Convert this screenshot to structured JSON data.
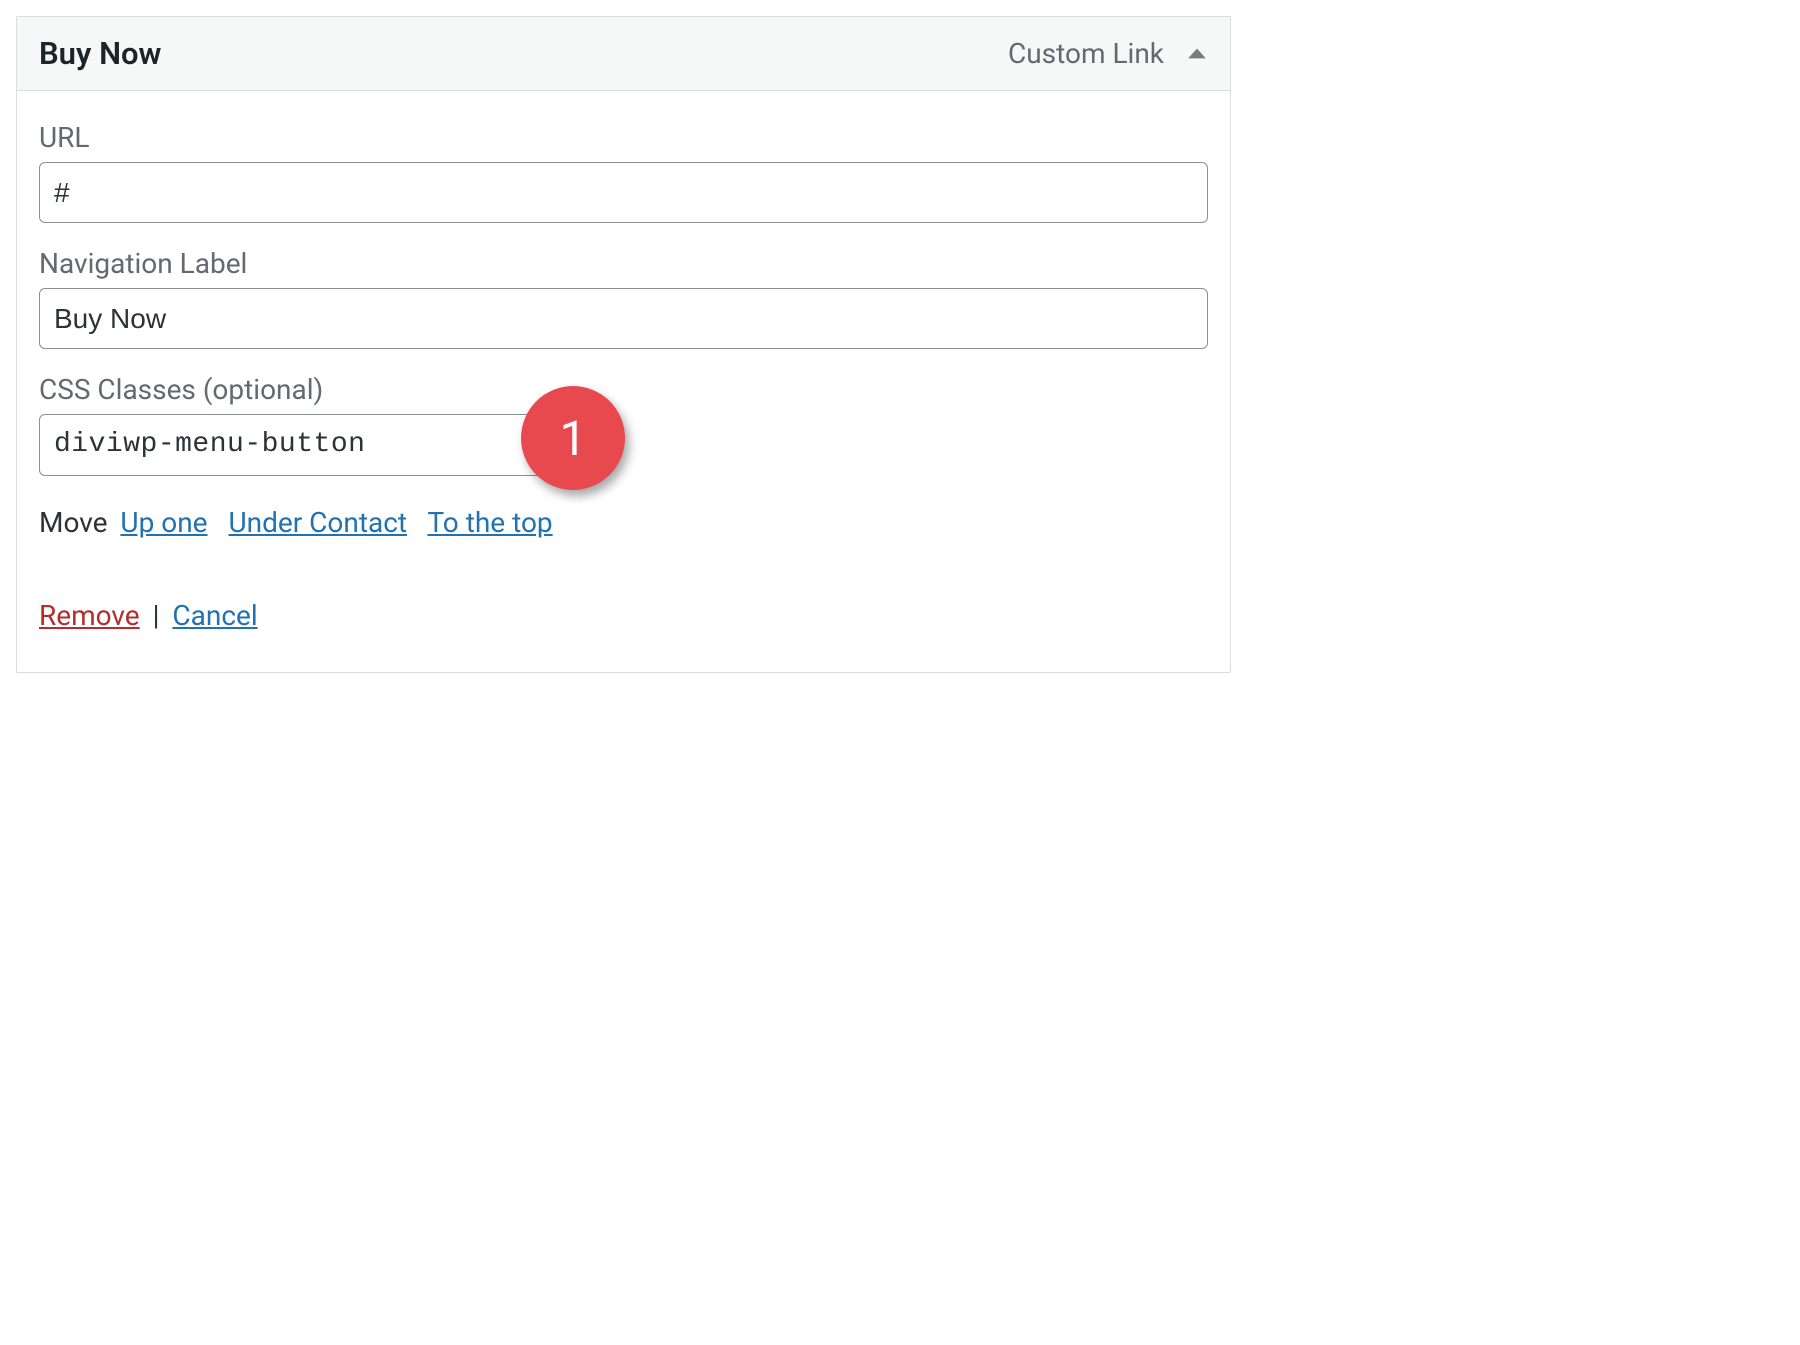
{
  "header": {
    "title": "Buy Now",
    "type": "Custom Link"
  },
  "fields": {
    "url": {
      "label": "URL",
      "value": "#"
    },
    "navigation_label": {
      "label": "Navigation Label",
      "value": "Buy Now"
    },
    "css_classes": {
      "label": "CSS Classes (optional)",
      "value": "diviwp-menu-button"
    }
  },
  "annotation": {
    "css_badge": "1"
  },
  "move": {
    "prefix": "Move",
    "up_one": "Up one",
    "under": "Under Contact",
    "to_top": "To the top"
  },
  "actions": {
    "remove": "Remove",
    "separator": "|",
    "cancel": "Cancel"
  }
}
